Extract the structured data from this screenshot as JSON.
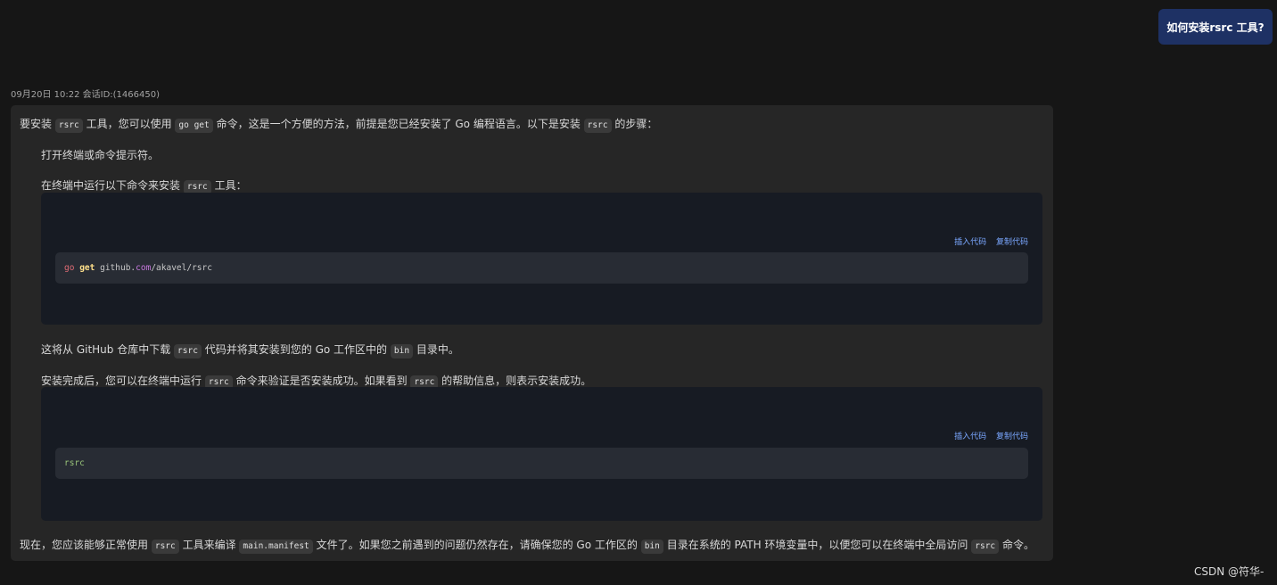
{
  "user_message": "如何安装rsrc 工具?",
  "meta": "09月20日 10:22 会话ID:(1466450)",
  "intro": {
    "a": "要安装",
    "code1": "rsrc",
    "b": "工具，您可以使用",
    "code2": "go get",
    "c": "命令，这是一个方便的方法，前提是您已经安装了 Go 编程语言。以下是安装",
    "code3": "rsrc",
    "d": "的步骤："
  },
  "step1": "打开终端或命令提示符。",
  "step2": {
    "a": "在终端中运行以下命令来安装",
    "code": "rsrc",
    "b": "工具："
  },
  "block1": {
    "insert": "插入代码",
    "copy": "复制代码",
    "tok_go": "go",
    "tok_get": "get",
    "tok_path_a": "github.",
    "tok_domain": "com",
    "tok_path_b": "/akavel/rsrc"
  },
  "para3": {
    "a": "这将从 GitHub 仓库中下载",
    "code1": "rsrc",
    "b": "代码并将其安装到您的 Go 工作区中的",
    "code2": "bin",
    "c": "目录中。"
  },
  "para4": {
    "a": "安装完成后，您可以在终端中运行",
    "code1": "rsrc",
    "b": "命令来验证是否安装成功。如果看到",
    "code2": "rsrc",
    "c": "的帮助信息，则表示安装成功。"
  },
  "block2": {
    "insert": "插入代码",
    "copy": "复制代码",
    "code": "rsrc"
  },
  "final": {
    "a": "现在，您应该能够正常使用",
    "code1": "rsrc",
    "b": "工具来编译",
    "code2": "main.manifest",
    "c": "文件了。如果您之前遇到的问题仍然存在，请确保您的 Go 工作区的",
    "code3": "bin",
    "d": "目录在系统的 PATH 环境变量中，以便您可以在终端中全局访问",
    "code4": "rsrc",
    "e": "命令。"
  },
  "watermark": "CSDN @符华-"
}
